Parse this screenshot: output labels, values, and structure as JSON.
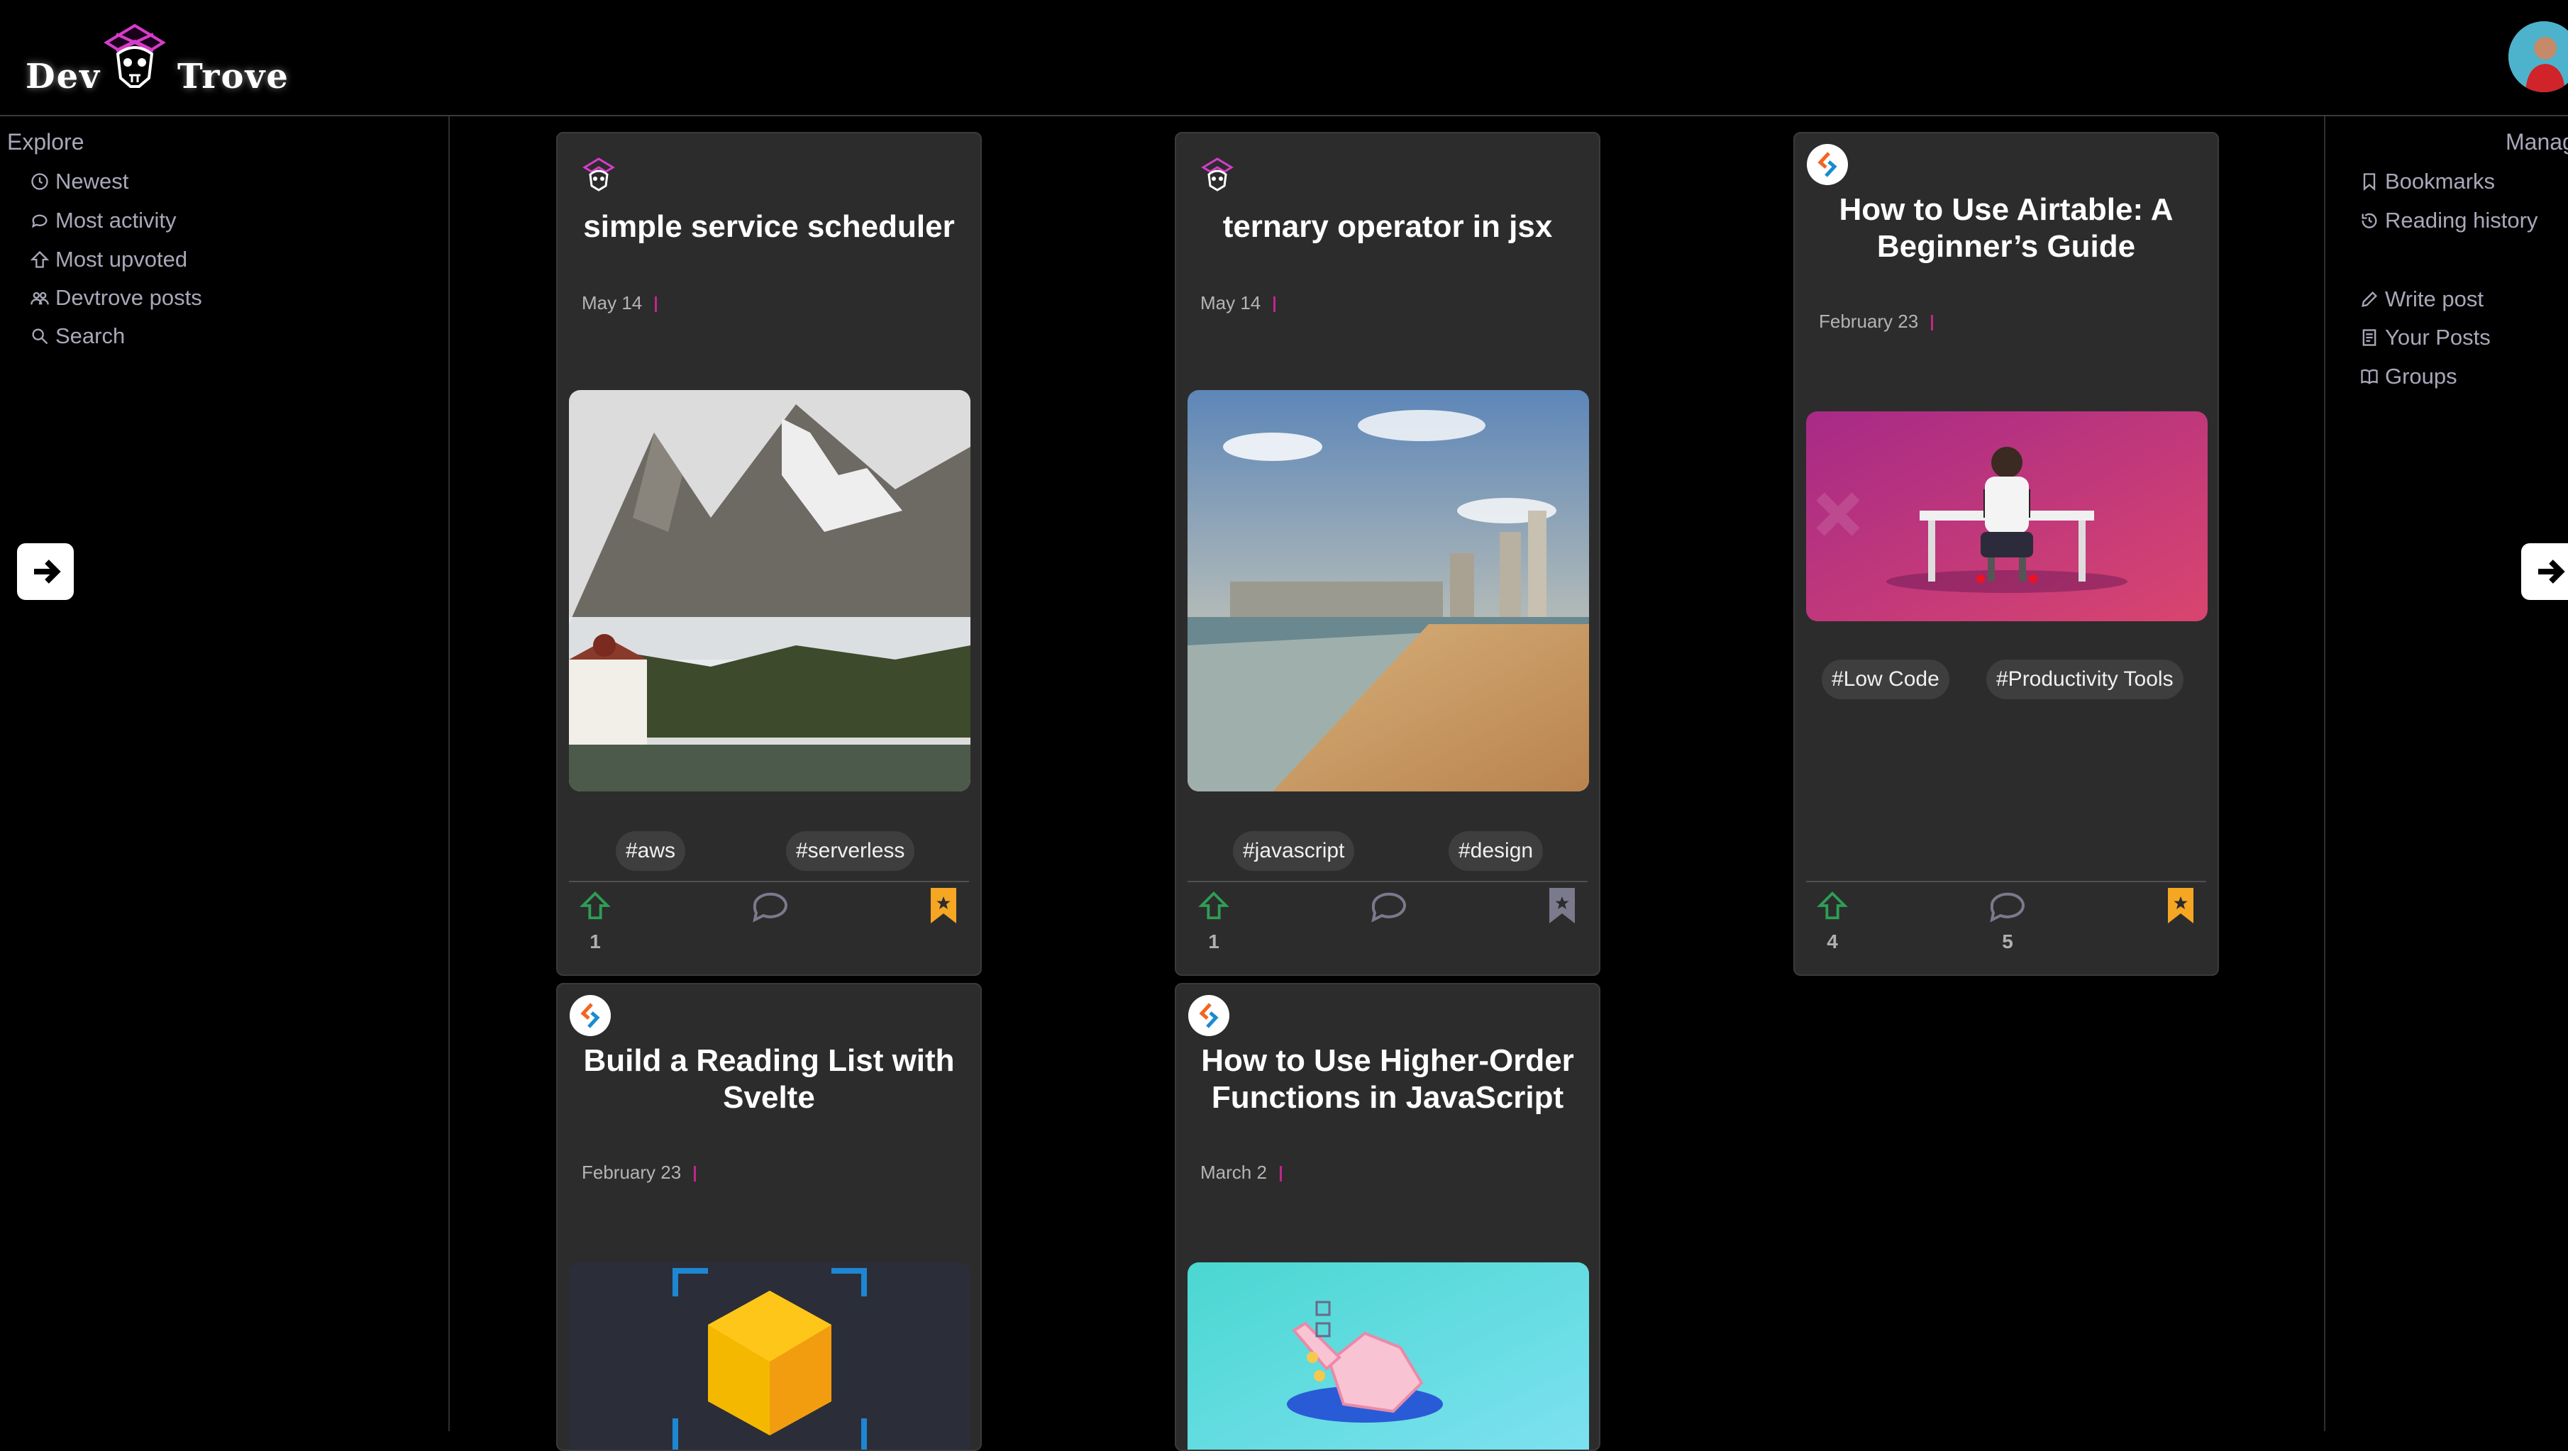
{
  "brand": {
    "word1": "Dev",
    "word2": "Trove"
  },
  "left_nav": {
    "heading": "Explore",
    "items": [
      {
        "label": "Newest",
        "icon": "clock-icon"
      },
      {
        "label": "Most activity",
        "icon": "chat-icon"
      },
      {
        "label": "Most upvoted",
        "icon": "upvote-icon"
      },
      {
        "label": "Devtrove posts",
        "icon": "group-icon"
      },
      {
        "label": "Search",
        "icon": "search-icon"
      }
    ]
  },
  "right_nav": {
    "heading": "Manage",
    "items": [
      {
        "label": "Bookmarks",
        "icon": "bookmark-icon"
      },
      {
        "label": "Reading history",
        "icon": "history-icon"
      },
      {
        "label": "Write post",
        "icon": "pencil-icon"
      },
      {
        "label": "Your Posts",
        "icon": "document-icon"
      },
      {
        "label": "Groups",
        "icon": "book-icon"
      }
    ]
  },
  "posts": [
    {
      "title": "simple service scheduler",
      "date": "May 14",
      "tags": [
        "#aws",
        "#serverless"
      ],
      "upvotes": "1",
      "comments": "",
      "bookmarked": true,
      "source": "devtrove",
      "image": "mountain-lake"
    },
    {
      "title": "ternary operator in jsx",
      "date": "May 14",
      "tags": [
        "#javascript",
        "#design"
      ],
      "upvotes": "1",
      "comments": "",
      "bookmarked": false,
      "source": "devtrove",
      "image": "beach-city"
    },
    {
      "title": "How to Use Airtable: A Beginner’s Guide",
      "date": "February 23",
      "tags": [
        "#Low Code",
        "#Productivity Tools"
      ],
      "upvotes": "4",
      "comments": "5",
      "bookmarked": true,
      "source": "sitepoint",
      "image": "desk-worker"
    },
    {
      "title": "Build a Reading List with Svelte",
      "date": "February 23",
      "tags": [],
      "source": "sitepoint",
      "image": "yellow-cube"
    },
    {
      "title": "How to Use Higher-Order Functions in JavaScript",
      "date": "March 2",
      "tags": [],
      "source": "sitepoint",
      "image": "pointing-hand"
    }
  ],
  "colors": {
    "upvote": "#2e9e55",
    "bookmark": "#f5a623",
    "bookmark_off": "#7a7a8c",
    "accent": "#c0268a"
  }
}
